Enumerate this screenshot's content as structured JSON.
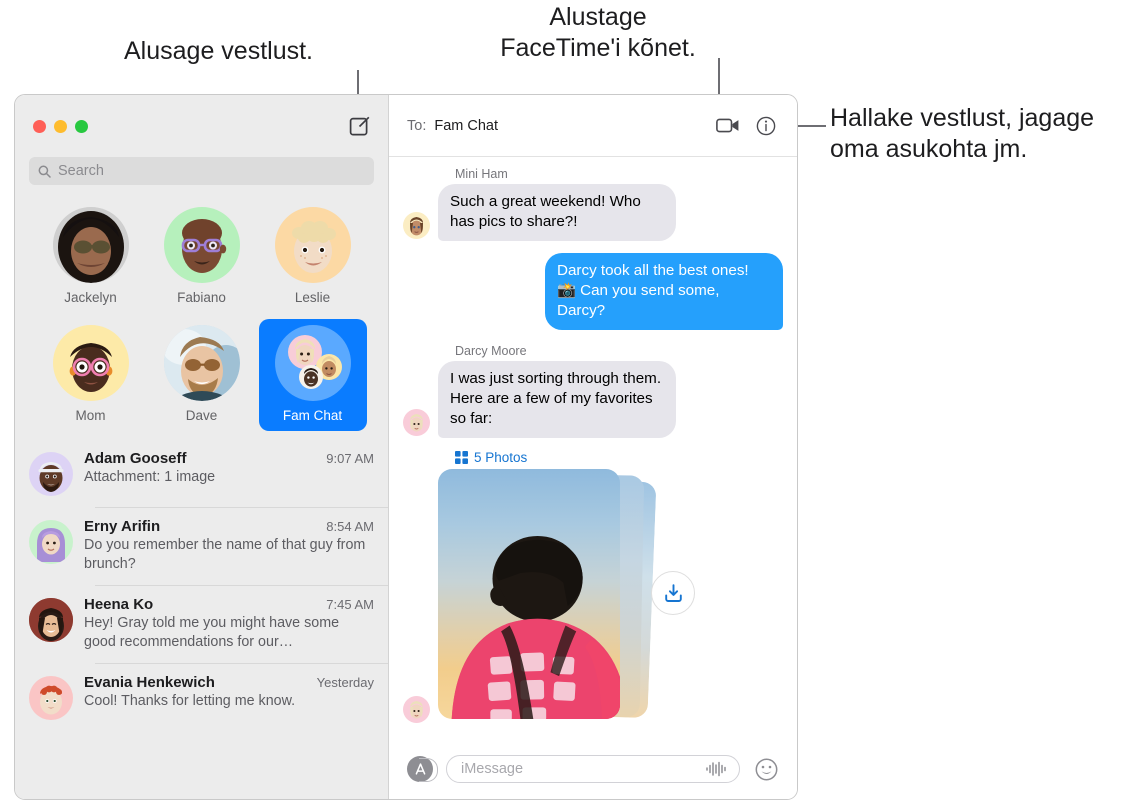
{
  "annotations": [
    {
      "id": "compose",
      "text": "Alusage vestlust."
    },
    {
      "id": "facetime",
      "text": "Alustage\nFaceTime'i kõnet."
    },
    {
      "id": "details",
      "text": "Hallake vestlust, jagage\noma asukohta jm."
    }
  ],
  "window": {
    "traffic_lights": [
      "close",
      "minimize",
      "zoom"
    ],
    "compose_icon": "compose-square-pencil-icon"
  },
  "sidebar": {
    "search": {
      "placeholder": "Search",
      "icon": "search-icon"
    },
    "pinned": [
      {
        "name": "Jackelyn",
        "avatar": "photo-woman-sunglasses",
        "selected": false
      },
      {
        "name": "Fabiano",
        "avatar": "memoji-green-purple-glasses",
        "selected": false
      },
      {
        "name": "Leslie",
        "avatar": "memoji-orange-blond-curls",
        "selected": false
      },
      {
        "name": "Mom",
        "avatar": "memoji-yellow-pink-glasses",
        "selected": false
      },
      {
        "name": "Dave",
        "avatar": "photo-man-sunglasses",
        "selected": false
      },
      {
        "name": "Fam Chat",
        "avatar": "group-memoji-trio",
        "selected": true
      }
    ],
    "conversations": [
      {
        "name": "Adam Gooseff",
        "time": "9:07 AM",
        "preview": "Attachment: 1 image",
        "avatar": "memoji-lavender-cap-beard"
      },
      {
        "name": "Erny Arifin",
        "time": "8:54 AM",
        "preview": "Do you remember the name of that guy from brunch?",
        "avatar": "memoji-green-purple-hijab"
      },
      {
        "name": "Heena Ko",
        "time": "7:45 AM",
        "preview": "Hey! Gray told me you might have some good recommendations for our…",
        "avatar": "photo-woman-smiling"
      },
      {
        "name": "Evania Henkewich",
        "time": "Yesterday",
        "preview": "Cool! Thanks for letting me know.",
        "avatar": "memoji-pink-red-hair"
      }
    ]
  },
  "chat": {
    "header": {
      "to_label": "To:",
      "to_value": "Fam Chat",
      "facetime_icon": "video-camera-icon",
      "details_icon": "info-circle-icon"
    },
    "messages": [
      {
        "sender": "Mini Ham",
        "direction": "in",
        "text": "Such a great weekend! Who has pics to share?!",
        "avatar": "memoji-cream-brown-hair"
      },
      {
        "sender": "",
        "direction": "out",
        "text": "Darcy took all the best ones! 📸 Can you send some, Darcy?",
        "avatar": ""
      },
      {
        "sender": "Darcy Moore",
        "direction": "in",
        "text": "I was just sorting through them. Here are a few of my favorites so far:",
        "avatar": "memoji-pink-blond"
      }
    ],
    "attachment": {
      "count_label": "5 Photos",
      "grid_icon": "grid-squares-icon",
      "download_icon": "download-tray-icon",
      "avatar": "memoji-pink-blond"
    },
    "composer": {
      "appstore_icon": "app-store-icon",
      "placeholder": "iMessage",
      "audio_icon": "audio-waveform-icon",
      "emoji_icon": "smiley-face-icon"
    }
  },
  "colors": {
    "accent_blue": "#0a7cff",
    "bubble_out": "#25a0fc",
    "bubble_in": "#e6e5eb",
    "link_blue": "#1675d1",
    "sidebar_bg": "#ececec",
    "traffic_red": "#ff5f57",
    "traffic_yellow": "#febc2e",
    "traffic_green": "#28c840"
  }
}
